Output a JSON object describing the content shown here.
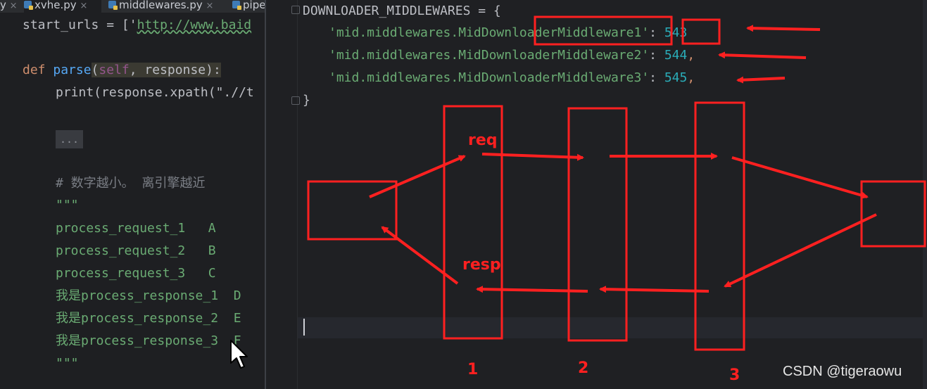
{
  "tabs": [
    {
      "label": "y",
      "close": "×"
    },
    {
      "label": "xvhe.py",
      "close": "×"
    },
    {
      "label": "middlewares.py",
      "close": "×"
    },
    {
      "label": "pipe",
      "close": ""
    }
  ],
  "left_code": {
    "line1_prefix": "start_urls = ['",
    "line1_url": "http://www.baid",
    "def_kw": "def",
    "def_name": "parse",
    "def_open": "(",
    "def_self": "self",
    "def_rest": ", response):",
    "print_call": "print(response.xpath(\".//t",
    "fold_label": "...",
    "comment": "# 数字越小。 离引擎越近",
    "docstring_open": "\"\"\"",
    "doc_lines": [
      "process_request_1   A",
      "process_request_2   B",
      "process_request_3   C",
      "我是process_response_1  D",
      "我是process_response_2  E",
      "我是process_response_3  F"
    ],
    "docstring_close": "\"\"\""
  },
  "right_code": {
    "dict_name": "DOWNLOADER_MIDDLEWARES = {",
    "entries": [
      {
        "key": "'mid.middlewares.MidDownloaderMiddleware1'",
        "sep": ": ",
        "value": "543",
        "tail": ""
      },
      {
        "key": "'mid.middlewares.MidDownloaderMiddleware2'",
        "sep": ": ",
        "value": "544",
        "tail": ","
      },
      {
        "key": "'mid.middlewares.MidDownloaderMiddleware3'",
        "sep": ": ",
        "value": "545",
        "tail": ","
      }
    ],
    "close_brace": "}"
  },
  "annotations": {
    "req_label": "req",
    "resp_label": "resp",
    "column_numbers": [
      "1",
      "2",
      "3"
    ],
    "ink_color": "#ff2020"
  },
  "watermark": "CSDN @tigeraowu"
}
